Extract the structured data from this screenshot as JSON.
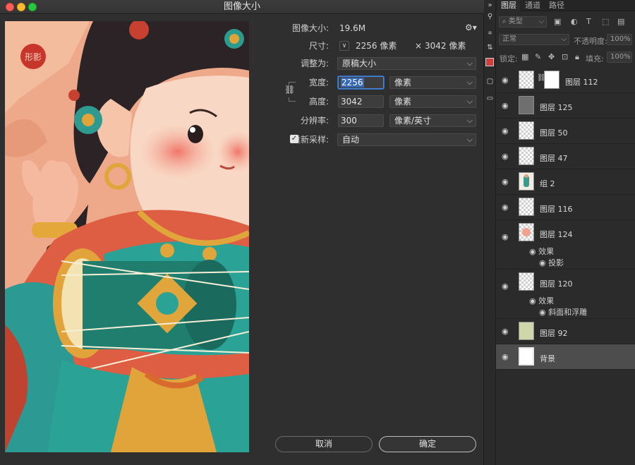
{
  "dialog": {
    "title": "图像大小",
    "image_size_label": "图像大小:",
    "image_size_value": "19.6M",
    "dimensions_label": "尺寸:",
    "dimensions_width": "2256 像素",
    "dimensions_times": "×",
    "dimensions_height": "3042 像素",
    "fit_to_label": "调整为:",
    "fit_to_value": "原稿大小",
    "width_label": "宽度:",
    "width_value": "2256",
    "width_unit": "像素",
    "height_label": "高度:",
    "height_value": "3042",
    "height_unit": "像素",
    "resolution_label": "分辨率:",
    "resolution_value": "300",
    "resolution_unit": "像素/英寸",
    "resample_label": "重新采样:",
    "resample_checked": true,
    "resample_value": "自动",
    "preview_seal_text": "形影",
    "cancel_label": "取消",
    "ok_label": "确定"
  },
  "layers_panel": {
    "tabs": [
      "图层",
      "通道",
      "路径"
    ],
    "filter_placeholder": "类型",
    "blend_mode": "正常",
    "opacity_label": "不透明度:",
    "opacity_value": "100%",
    "lock_label": "锁定:",
    "fill_label": "填充:",
    "fill_value": "100%",
    "layers": [
      {
        "name": "图层 112",
        "visible": true,
        "thumb": "mask"
      },
      {
        "name": "图层 125",
        "visible": true,
        "thumb": "gray"
      },
      {
        "name": "图层 50",
        "visible": true,
        "thumb": "transparent"
      },
      {
        "name": "图层 47",
        "visible": true,
        "thumb": "transparent"
      },
      {
        "name": "组 2",
        "visible": true,
        "thumb": "figure"
      },
      {
        "name": "图层 116",
        "visible": true,
        "thumb": "transparent"
      },
      {
        "name": "图层 124",
        "visible": true,
        "thumb": "pink",
        "effects_label": "效果",
        "effects": [
          "投影"
        ]
      },
      {
        "name": "图层 120",
        "visible": true,
        "thumb": "transparent",
        "effects_label": "效果",
        "effects": [
          "斜面和浮雕"
        ]
      },
      {
        "name": "图层 92",
        "visible": true,
        "thumb": "green"
      },
      {
        "name": "背景",
        "visible": true,
        "thumb": "white",
        "selected": true
      }
    ]
  },
  "colors": {
    "accent": "#3567b4",
    "dialog_bg": "#2f2f2f",
    "panel_bg": "#2b2b2b"
  }
}
